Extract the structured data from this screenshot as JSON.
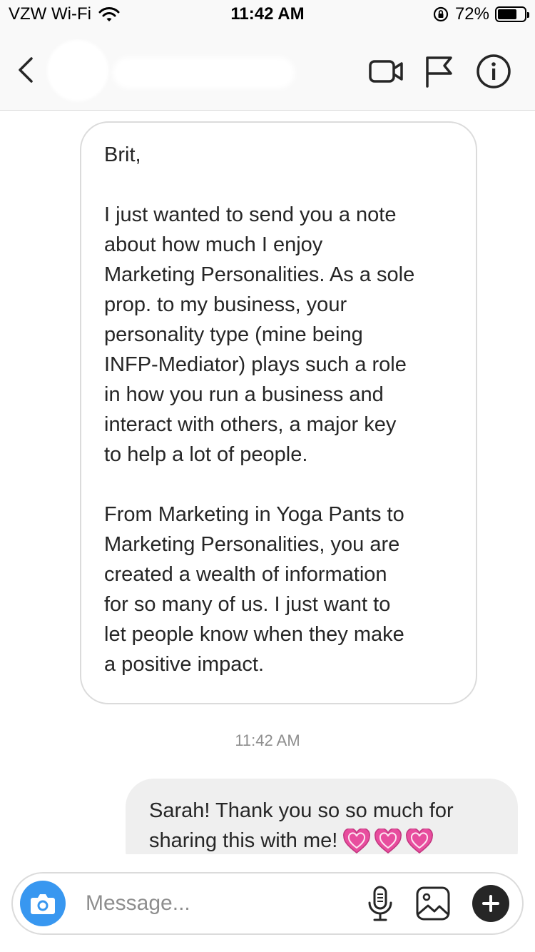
{
  "status_bar": {
    "carrier": "VZW Wi-Fi",
    "time": "11:42 AM",
    "battery_percent": "72%",
    "battery_level": 0.72,
    "icons": [
      "wifi-icon",
      "rotation-lock-icon",
      "battery-icon"
    ]
  },
  "header": {
    "icons": [
      "back-chevron-icon",
      "video-call-icon",
      "flag-icon",
      "info-icon"
    ]
  },
  "messages": [
    {
      "direction": "received",
      "text": "Brit,\n\nI just wanted to send you a note\nabout how much I enjoy\nMarketing Personalities. As a sole\nprop. to my business, your\npersonality type (mine being\nINFP-Mediator) plays such a role\nin how you run a business and\ninteract with others, a major key\nto help a lot of people.\n\nFrom Marketing in Yoga Pants to\nMarketing Personalities, you are\ncreated a wealth of information\nfor so many of us. I just want to\nlet people know when they make\na positive impact."
    },
    {
      "direction": "sent",
      "text": "Sarah! Thank you so so much for\nsharing this with me!",
      "emoji": [
        "growing-heart",
        "growing-heart",
        "growing-heart"
      ]
    }
  ],
  "timestamp": "11:42 AM",
  "composer": {
    "placeholder": "Message...",
    "icons": [
      "camera-icon",
      "microphone-icon",
      "gallery-icon",
      "plus-icon"
    ]
  },
  "colors": {
    "camera_button": "#3897f0",
    "heart": "#e84d9e",
    "sent_bubble": "#efefef",
    "received_border": "#dbdbdb"
  }
}
